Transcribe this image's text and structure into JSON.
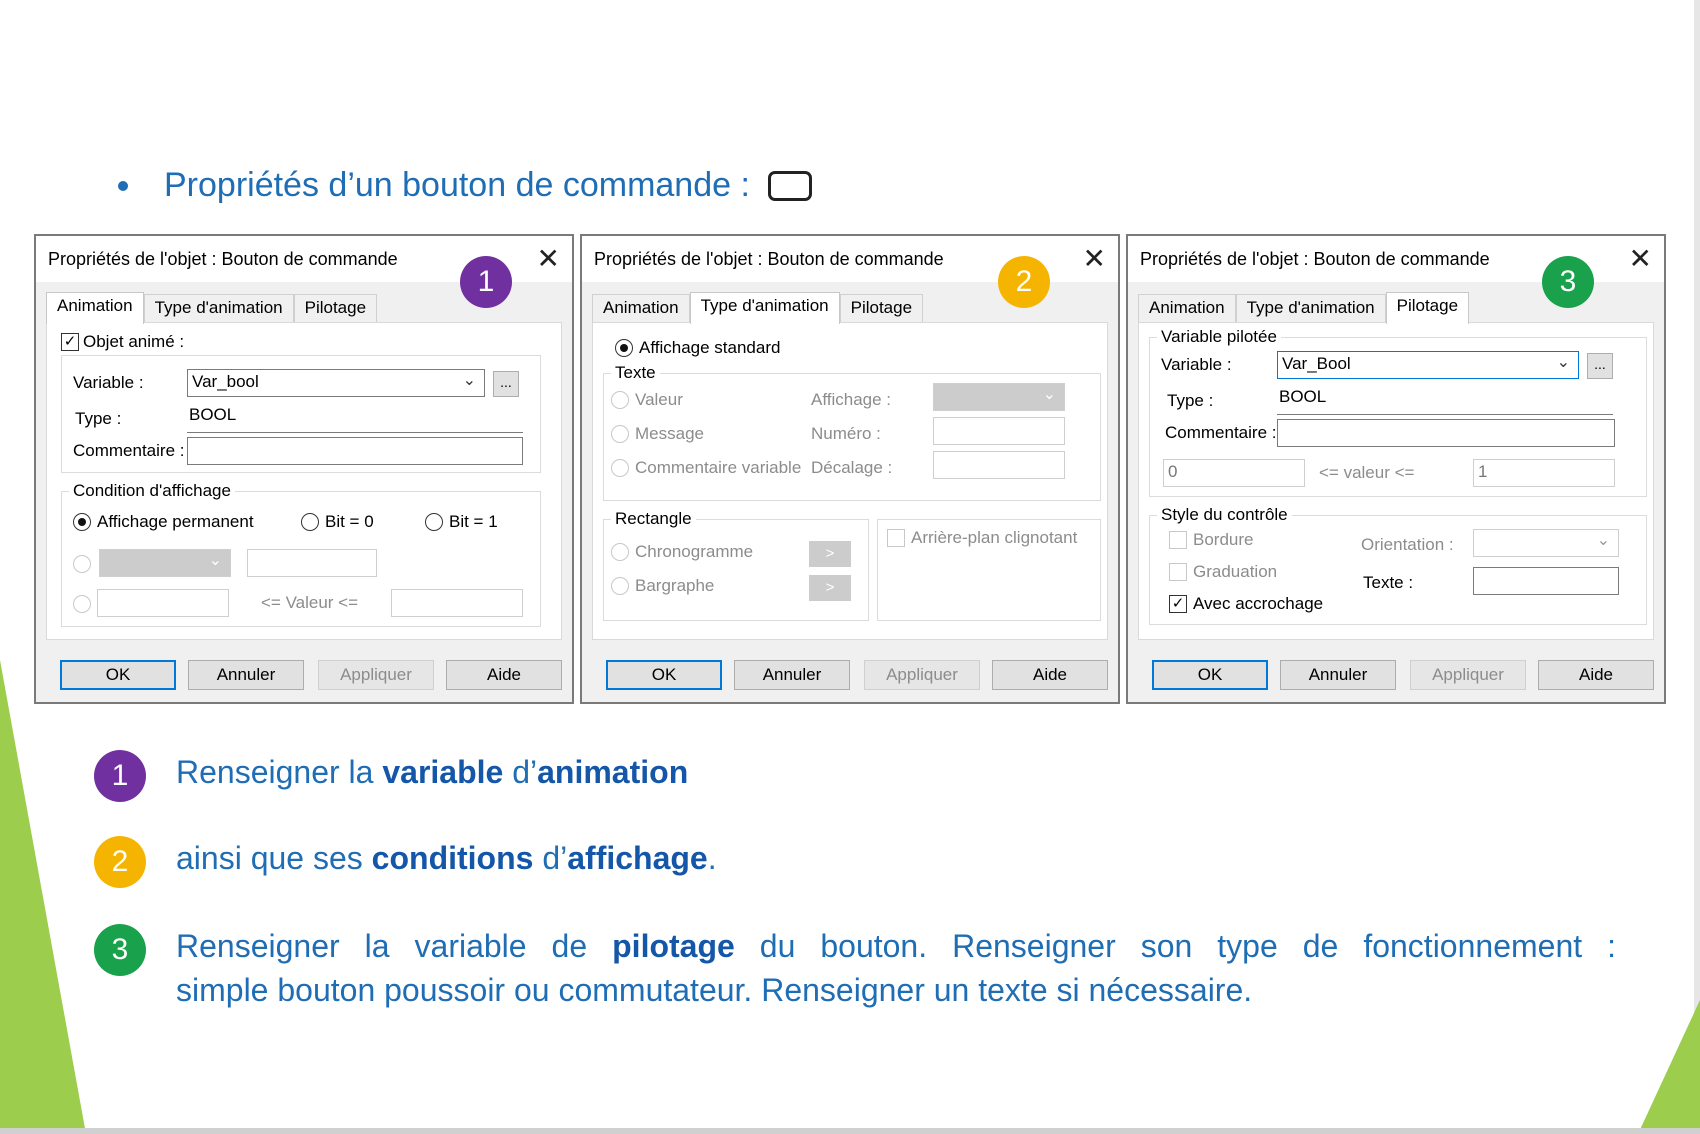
{
  "slide": {
    "title": "Propriétés d’un bouton de commande :",
    "steps": [
      {
        "num": "1",
        "color": "#7030a0",
        "parts": [
          "Renseigner la ",
          "variable",
          " d’",
          "animation",
          ""
        ]
      },
      {
        "num": "2",
        "color": "#f5b400",
        "parts": [
          "ainsi que ses ",
          "conditions",
          " d’",
          "affichage",
          "."
        ]
      },
      {
        "num": "3",
        "color": "#1aa14b",
        "line1_a": "Renseigner la variable de ",
        "line1_b": "pilotage",
        "line1_c": " du bouton. Renseigner son type de fonctionnement :",
        "line2": "simple bouton poussoir ou commutateur. Renseigner un texte si nécessaire."
      }
    ]
  },
  "dialog_title": "Propriétés de l'objet : Bouton de commande",
  "tabs": [
    "Animation",
    "Type d'animation",
    "Pilotage"
  ],
  "buttons": {
    "ok": "OK",
    "cancel": "Annuler",
    "apply": "Appliquer",
    "help": "Aide"
  },
  "dialog1": {
    "badge": "1",
    "badge_color": "#7030a0",
    "objet_anime": "Objet animé :",
    "variable_label": "Variable :",
    "variable_value": "Var_bool",
    "browse": "...",
    "type_label": "Type :",
    "type_value": "BOOL",
    "comment_label": "Commentaire :",
    "comment_value": "",
    "condition_group": "Condition d'affichage",
    "affichage_permanent": "Affichage permanent",
    "bit0": "Bit = 0",
    "bit1": "Bit = 1",
    "valeur_range": "<=  Valeur  <="
  },
  "dialog2": {
    "badge": "2",
    "badge_color": "#f5b400",
    "affichage_standard": "Affichage standard",
    "texte_group": "Texte",
    "valeur": "Valeur",
    "message": "Message",
    "commentaire_variable": "Commentaire variable",
    "affichage_label": "Affichage :",
    "numero_label": "Numéro :",
    "decalage_label": "Décalage :",
    "rectangle_group": "Rectangle",
    "chronogramme": "Chronogramme",
    "bargraphe": "Bargraphe",
    "arrow": ">",
    "arriere_plan": "Arrière-plan clignotant"
  },
  "dialog3": {
    "badge": "3",
    "badge_color": "#1aa14b",
    "variable_pilotee_group": "Variable pilotée",
    "variable_label": "Variable :",
    "variable_value": "Var_Bool",
    "browse": "...",
    "type_label": "Type :",
    "type_value": "BOOL",
    "comment_label": "Commentaire :",
    "comment_value": "",
    "min_value": "0",
    "max_value": "1",
    "valeur_range": "<=  valeur  <=",
    "style_group": "Style du contrôle",
    "bordure": "Bordure",
    "graduation": "Graduation",
    "avec_accrochage": "Avec accrochage",
    "orientation_label": "Orientation :",
    "texte_label": "Texte :",
    "texte_value": ""
  }
}
